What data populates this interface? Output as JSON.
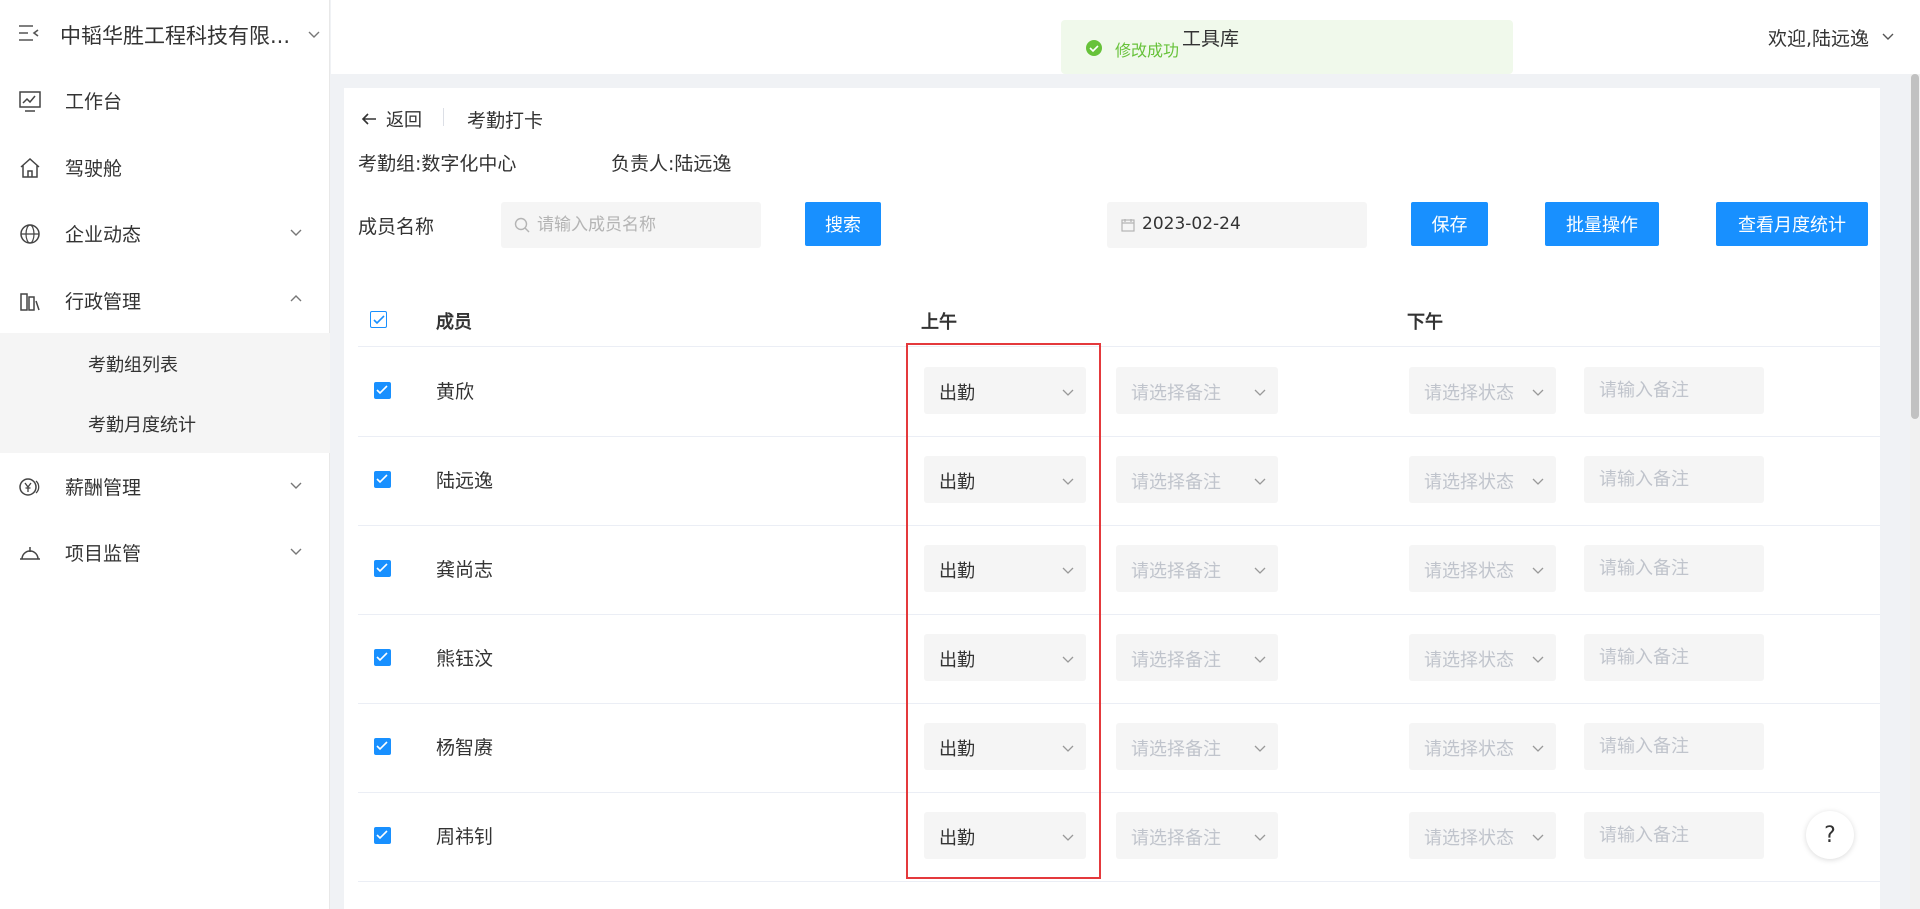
{
  "sidebar": {
    "company": "中韬华胜工程科技有限...",
    "items": [
      {
        "label": "工作台",
        "icon": "chart-icon"
      },
      {
        "label": "驾驶舱",
        "icon": "home-icon"
      },
      {
        "label": "企业动态",
        "icon": "globe-icon"
      },
      {
        "label": "行政管理",
        "icon": "building-icon"
      },
      {
        "label": "薪酬管理",
        "icon": "yen-icon"
      },
      {
        "label": "项目监管",
        "icon": "helmet-icon"
      }
    ],
    "sub_items": [
      {
        "label": "考勤组列表"
      },
      {
        "label": "考勤月度统计"
      }
    ]
  },
  "header": {
    "toast": "修改成功",
    "tools": "工具库",
    "welcome": "欢迎,陆远逸"
  },
  "page": {
    "back": "返回",
    "title": "考勤打卡",
    "group": "考勤组:数字化中心",
    "owner": "负责人:陆远逸"
  },
  "filter": {
    "label": "成员名称",
    "search_placeholder": "请输入成员名称",
    "search_btn": "搜索",
    "date": "2023-02-24",
    "save_btn": "保存",
    "batch_btn": "批量操作",
    "monthly_btn": "查看月度统计"
  },
  "table": {
    "headers": {
      "member": "成员",
      "am": "上午",
      "pm": "下午"
    },
    "note_placeholder": "请选择备注",
    "pm_status_placeholder": "请选择状态",
    "pm_note_placeholder": "请输入备注",
    "rows": [
      {
        "name": "黄欣",
        "am_status": "出勤"
      },
      {
        "name": "陆远逸",
        "am_status": "出勤"
      },
      {
        "name": "龚尚志",
        "am_status": "出勤"
      },
      {
        "name": "熊钰汶",
        "am_status": "出勤"
      },
      {
        "name": "杨智赓",
        "am_status": "出勤"
      },
      {
        "name": "周祎钊",
        "am_status": "出勤"
      }
    ]
  },
  "help": "?",
  "colors": {
    "primary": "#1890ff",
    "success": "#67c23a",
    "highlight": "#e4393c"
  }
}
